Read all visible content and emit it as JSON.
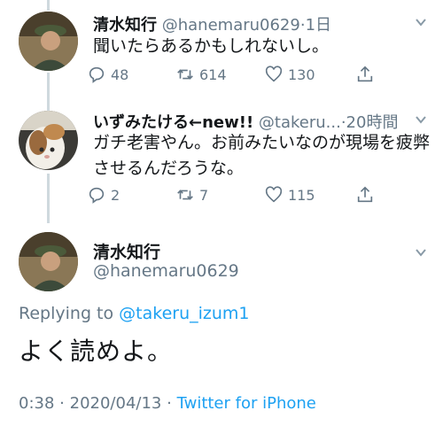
{
  "tweets": [
    {
      "name": "清水知行",
      "handle": "@hanemaru0629",
      "time": "1日",
      "separator": "·",
      "text": "聞いたらあるかもしれないし。",
      "replies": "48",
      "retweets": "614",
      "likes": "130"
    },
    {
      "name": "いずみたける←new!!",
      "handle": "@takeru...",
      "time": "20時間",
      "separator": "·",
      "text_line1": "ガチ老害やん。お前みたいなのが現場を疲弊",
      "text_line2": "させるんだろうな。",
      "replies": "2",
      "retweets": "7",
      "likes": "115"
    }
  ],
  "main_tweet": {
    "name": "清水知行",
    "handle": "@hanemaru0629",
    "replying_label": "Replying to",
    "replying_to": "@takeru_izum1",
    "text": "よく読めよ。",
    "time": "0:38",
    "date": "2020/04/13",
    "separator": "·",
    "source": "Twitter for iPhone"
  },
  "icons": [
    "reply-icon",
    "retweet-icon",
    "like-icon",
    "share-icon",
    "chevron-down-icon"
  ],
  "colors": {
    "accent": "#1da1f2",
    "secondary_text": "#657786",
    "thread_line": "#cfd9de"
  }
}
